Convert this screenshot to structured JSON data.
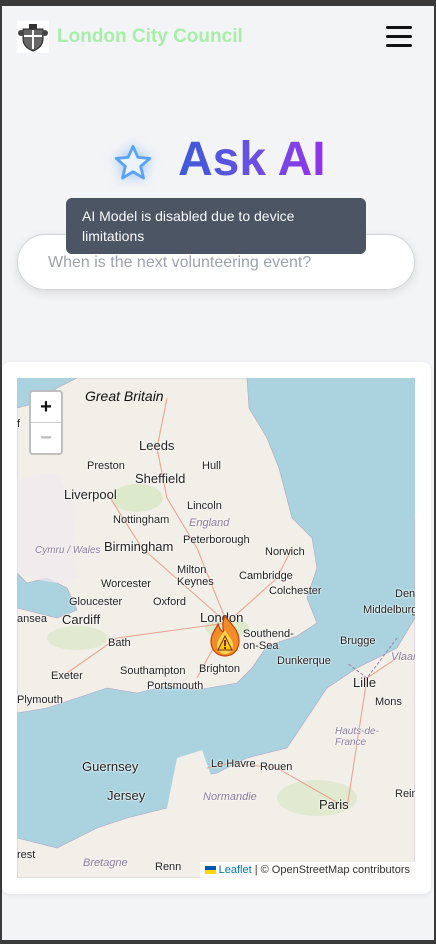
{
  "header": {
    "brand": "London City Council",
    "logo": "coat-of-arms-icon",
    "menu_icon": "hamburger-menu-icon"
  },
  "hero": {
    "title": "Ask AI",
    "icon": "star-icon"
  },
  "search": {
    "placeholder": "When is the next volunteering event?",
    "value": ""
  },
  "tooltip": {
    "text": "AI Model is disabled due to device limitations"
  },
  "map": {
    "zoom_in": "+",
    "zoom_out": "−",
    "labels": {
      "great_britain": "Great Britain",
      "england": "England",
      "cymru_wales": "Cymru / Wales",
      "normandie": "Normandie",
      "hauts_de_france": "Hauts-de-France",
      "bretagne": "Bretagne",
      "vlaan": "Vlaan"
    },
    "cities": {
      "leeds": "Leeds",
      "preston": "Preston",
      "hull": "Hull",
      "sheffield": "Sheffield",
      "liverpool": "Liverpool",
      "lincoln": "Lincoln",
      "nottingham": "Nottingham",
      "birmingham": "Birmingham",
      "peterborough": "Peterborough",
      "norwich": "Norwich",
      "worcester": "Worcester",
      "milton_keynes": "Milton\nKeynes",
      "cambridge": "Cambridge",
      "gloucester": "Gloucester",
      "oxford": "Oxford",
      "colchester": "Colchester",
      "cardiff": "Cardiff",
      "swansea": "ansea",
      "london": "London",
      "southend": "Southend-\non-Sea",
      "bath": "Bath",
      "dunkerque": "Dunkerque",
      "brugge": "Brugge",
      "middelburg": "Middelburg",
      "exeter": "Exeter",
      "southampton": "Southampton",
      "portsmouth": "Portsmouth",
      "brighton": "Brighton",
      "lille": "Lille",
      "mons": "Mons",
      "plymouth": "Plymouth",
      "guernsey": "Guernsey",
      "jersey": "Jersey",
      "le_havre": "Le Havre",
      "rouen": "Rouen",
      "paris": "Paris",
      "reim": "Reim",
      "rest": "rest",
      "renn": "Renn",
      "den": "Den",
      "ff": "f"
    },
    "marker_icon": "fire-warning-marker-icon",
    "attribution": {
      "leaflet": "Leaflet",
      "rest": " | © OpenStreetMap contributors"
    }
  }
}
